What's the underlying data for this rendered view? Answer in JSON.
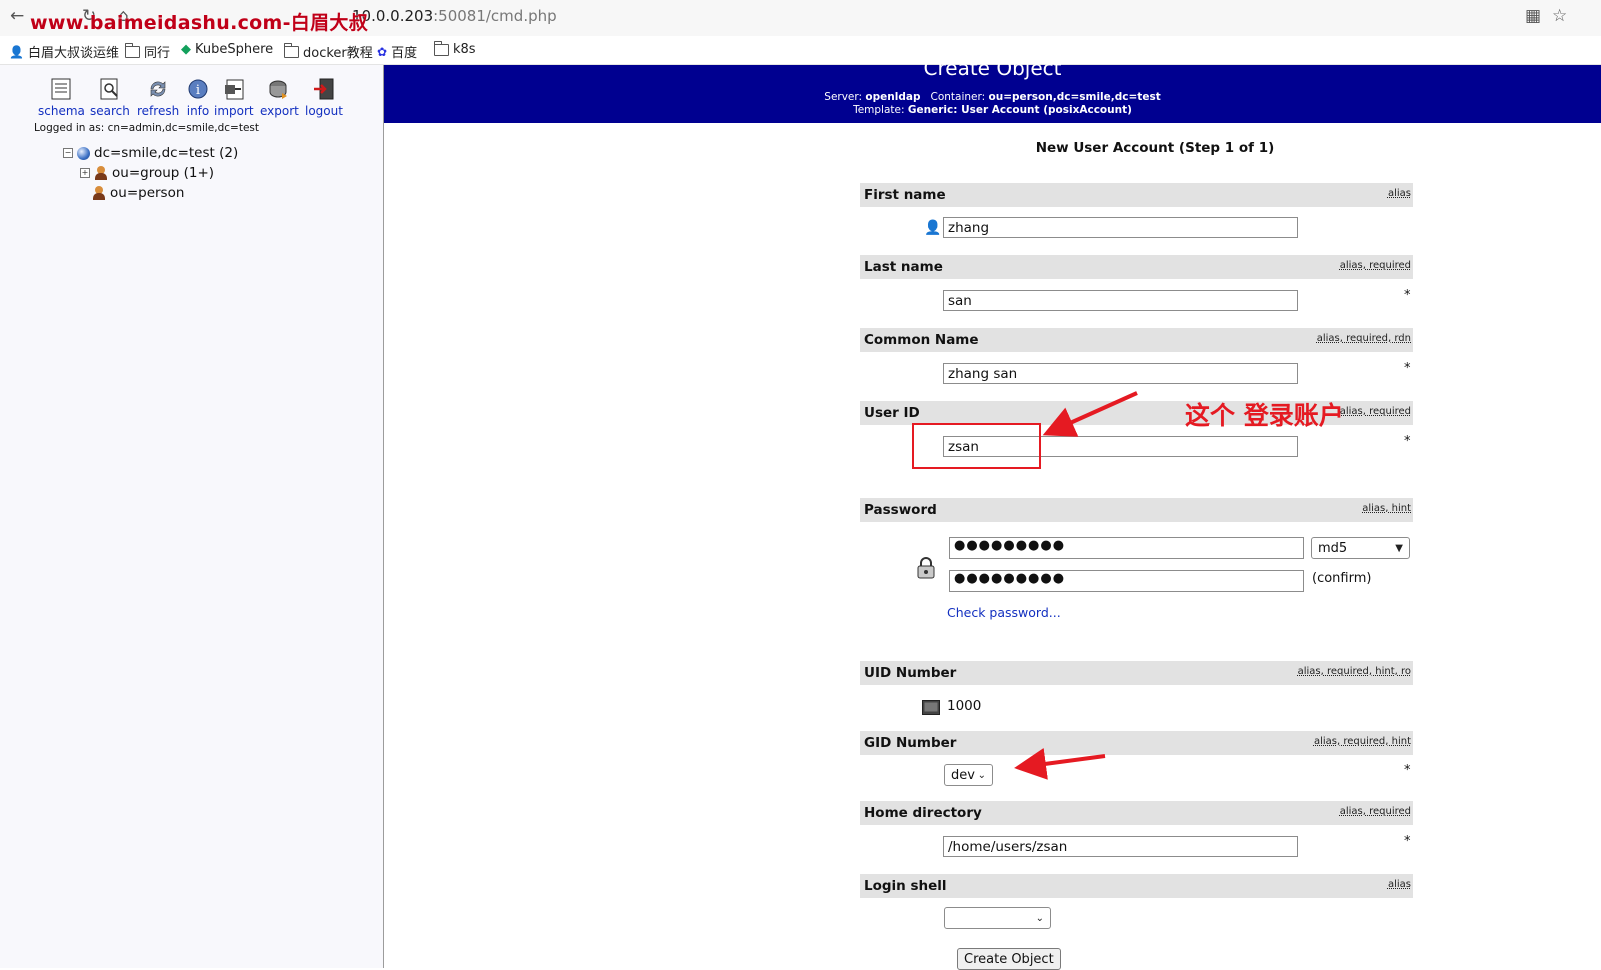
{
  "browser": {
    "url_host": "10.0.0.203",
    "url_rest": ":50081/cmd.php",
    "watermark": "www.baimeidashu.com-白眉大叔",
    "bookmarks": [
      "白眉大叔谈运维",
      "同行",
      "KubeSphere",
      "docker教程",
      "百度",
      "k8s"
    ]
  },
  "tree": {
    "tools": [
      "schema",
      "search",
      "refresh",
      "info",
      "import",
      "export",
      "logout"
    ],
    "logged_in": "Logged in as: cn=admin,dc=smile,dc=test",
    "root": "dc=smile,dc=test (2)",
    "children": [
      "ou=group (1+)",
      "ou=person"
    ]
  },
  "header": {
    "title": "Create Object",
    "server_label": "Server:",
    "server": "openldap",
    "container_label": "Container:",
    "container": "ou=person,dc=smile,dc=test",
    "template_label": "Template:",
    "template": "Generic: User Account (posixAccount)"
  },
  "form": {
    "heading": "New User Account (Step 1 of 1)",
    "first_name": {
      "label": "First name",
      "flags": "alias",
      "value": "zhang"
    },
    "last_name": {
      "label": "Last name",
      "flags": "alias, required",
      "value": "san"
    },
    "common_name": {
      "label": "Common Name",
      "flags": "alias, required, rdn",
      "value": "zhang san"
    },
    "user_id": {
      "label": "User ID",
      "flags": "alias, required",
      "value": "zsan"
    },
    "password": {
      "label": "Password",
      "flags": "alias, hint",
      "value": "●●●●●●●●●",
      "confirm_value": "●●●●●●●●●",
      "hash": "md5",
      "confirm_label": "(confirm)",
      "check_link": "Check password..."
    },
    "uid_number": {
      "label": "UID Number",
      "flags": "alias, required, hint, ro",
      "value": "1000"
    },
    "gid_number": {
      "label": "GID Number",
      "flags": "alias, required, hint",
      "value": "dev"
    },
    "home_directory": {
      "label": "Home directory",
      "flags": "alias, required",
      "value": "/home/users/zsan"
    },
    "login_shell": {
      "label": "Login shell",
      "flags": "alias",
      "value": ""
    },
    "required_mark": "*",
    "submit": "Create Object"
  },
  "annotation": {
    "text": "这个 登录账户",
    "color": "#e51a22"
  }
}
